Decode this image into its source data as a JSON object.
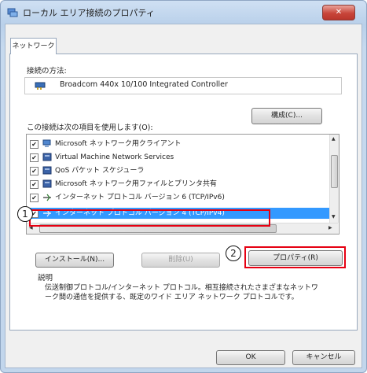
{
  "window": {
    "title": "ローカル エリア接続のプロパティ",
    "close_label": "✕"
  },
  "tabs": [
    {
      "label": "ネットワーク"
    }
  ],
  "connect_using": {
    "label": "接続の方法:",
    "adapter": "Broadcom 440x 10/100 Integrated Controller"
  },
  "configure_button": "構成(C)...",
  "items_label": "この接続は次の項目を使用します(O):",
  "items": [
    {
      "label": "Microsoft ネットワーク用クライアント",
      "checked": true,
      "icon": "network-client-icon"
    },
    {
      "label": "Virtual Machine Network Services",
      "checked": true,
      "icon": "service-icon"
    },
    {
      "label": "QoS パケット スケジューラ",
      "checked": true,
      "icon": "service-icon"
    },
    {
      "label": "Microsoft ネットワーク用ファイルとプリンタ共有",
      "checked": true,
      "icon": "service-icon"
    },
    {
      "label": "インターネット プロトコル バージョン 6 (TCP/IPv6)",
      "checked": true,
      "icon": "protocol-icon"
    },
    {
      "label": "インターネット プロトコル バージョン 4 (TCP/IPv4)",
      "checked": true,
      "icon": "protocol-icon",
      "selected": true
    }
  ],
  "buttons": {
    "install": "インストール(N)...",
    "uninstall": "削除(U)",
    "properties": "プロパティ(R)"
  },
  "description": {
    "label": "説明",
    "text": "伝送制御プロトコル/インターネット プロトコル。相互接続されたさまざまなネットワーク間の通信を提供する、既定のワイド エリア ネットワーク プロトコルです。"
  },
  "footer": {
    "ok": "OK",
    "cancel": "キャンセル"
  },
  "annotations": {
    "marker1": "1",
    "marker2": "2"
  },
  "colors": {
    "highlight_red": "#e60012",
    "selection_blue": "#3399ff"
  }
}
